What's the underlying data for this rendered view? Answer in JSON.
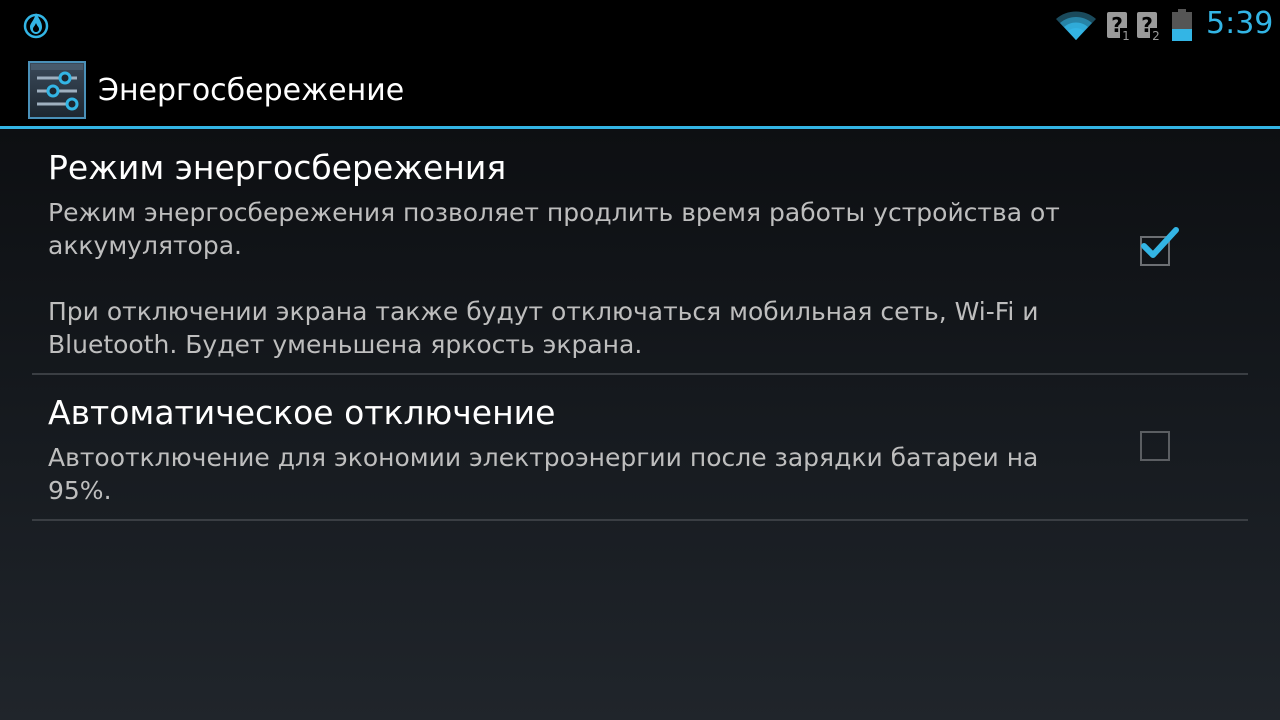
{
  "status_bar": {
    "left_icon": "flame-notification-icon",
    "icons": [
      "wifi-icon",
      "sim-1-unknown-icon",
      "sim-2-unknown-icon",
      "battery-icon"
    ],
    "time": "5:39",
    "accent_color": "#33b5e5"
  },
  "action_bar": {
    "icon": "settings-sliders-icon",
    "title": "Энергосбережение"
  },
  "preferences": [
    {
      "title": "Режим энергосбережения",
      "summary_1": "Режим энергосбережения позволяет продлить время работы устройства от аккумулятора.",
      "summary_2": "При отключении экрана также будут отключаться мобильная сеть, Wi-Fi и Bluetooth. Будет уменьшена яркость экрана.",
      "checked": true
    },
    {
      "title": "Автоматическое отключение",
      "summary_1": "Автоотключение для экономии электроэнергии после зарядки батареи на 95%.",
      "checked": false
    }
  ]
}
